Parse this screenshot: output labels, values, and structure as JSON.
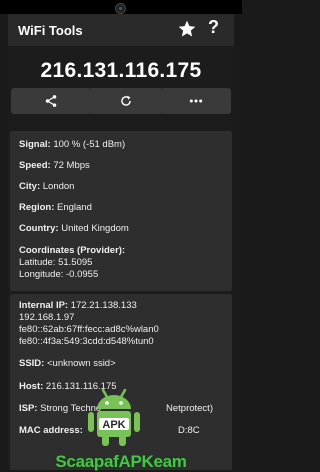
{
  "app": {
    "title": "WiFi Tools"
  },
  "header": {
    "ip_address": "216.131.116.175"
  },
  "card1": {
    "signal_label": "Signal:",
    "signal_value": "100 % (-51 dBm)",
    "speed_label": "Speed:",
    "speed_value": "72 Mbps",
    "city_label": "City:",
    "city_value": "London",
    "region_label": "Region:",
    "region_value": "England",
    "country_label": "Country:",
    "country_value": "United Kingdom",
    "coords_label": "Coordinates (Provider):",
    "latitude": "Latitude: 51.5095",
    "longitude": "Longitude: -0.0955"
  },
  "card2": {
    "internal_ip_label": "Internal IP:",
    "internal_ip_1": "172.21.138.133",
    "internal_ip_2": "192.168.1.97",
    "internal_ip_3": "fe80::62ab:67ff:fecc:ad8c%wlan0",
    "internal_ip_4": "fe80::4f3a:549:3cdd:d548%tun0",
    "ssid_label": "SSID:",
    "ssid_value": "<unknown ssid>",
    "host_label": "Host:",
    "host_value": "216.131.116.175",
    "isp_label": "ISP:",
    "isp_value": "Strong Techno",
    "isp_value_2": "Netprotect)",
    "mac_label": "MAC address:",
    "mac_value": "D:8C"
  },
  "watermark": {
    "text": "ScaapafAPKeam"
  },
  "colors": {
    "background": "#1c1c1c",
    "card": "#2e2e2e",
    "button": "#3a3a3a",
    "accent_green": "#4cc04c",
    "android_green": "#78c257"
  },
  "icons": {
    "star": "star-icon",
    "help": "help-icon",
    "share": "share-icon",
    "refresh": "refresh-icon",
    "more": "more-icon"
  }
}
